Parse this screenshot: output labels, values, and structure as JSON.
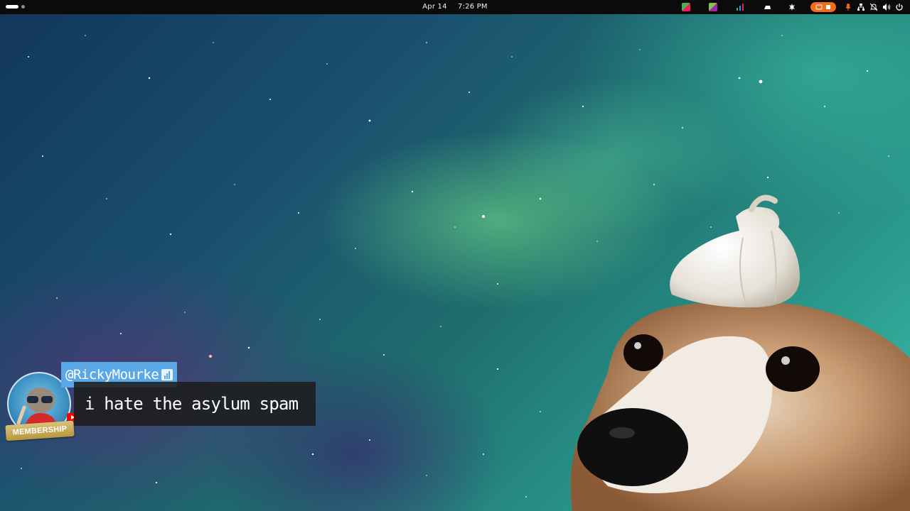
{
  "topbar": {
    "date": "Apr 14",
    "time": "7:26 PM",
    "tray_icons": [
      "app-indicator-icon",
      "app-indicator-icon",
      "chart-indicator-icon",
      "drive-icon",
      "settings-tray-icon",
      "screen-record-icon",
      "microphone-icon",
      "network-icon",
      "notifications-off-icon",
      "volume-icon",
      "power-icon"
    ]
  },
  "chat": {
    "username": "@RickyMourke",
    "badge": "MEMBERSHIP",
    "message": "i hate the asylum spam"
  },
  "colors": {
    "username_bg": "#5aa9e6",
    "message_bg": "#1c1c1c",
    "record_pill": "#f26a1b",
    "membership_badge": "#c9ad5a",
    "youtube_red": "#ff0000"
  }
}
